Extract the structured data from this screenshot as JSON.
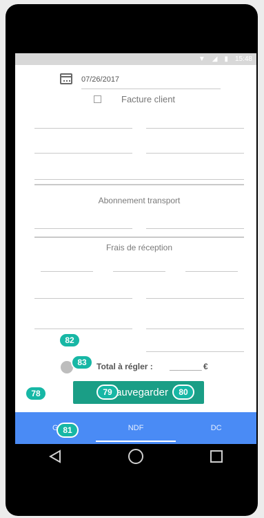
{
  "statusbar": {
    "time": "15:48"
  },
  "form": {
    "date_value": "07/26/2017",
    "checkbox_label": "Facture client",
    "section1_title": "Abonnement transport",
    "section2_title": "Frais de réception",
    "total_label": "Total à régler :",
    "total_value": "_______",
    "currency": "€",
    "save_label": "Sauvegarder"
  },
  "tabs": [
    {
      "label": "G"
    },
    {
      "label": "NDF"
    },
    {
      "label": "DC"
    }
  ],
  "badges": [
    "82",
    "83",
    "78",
    "79",
    "80",
    "81"
  ]
}
